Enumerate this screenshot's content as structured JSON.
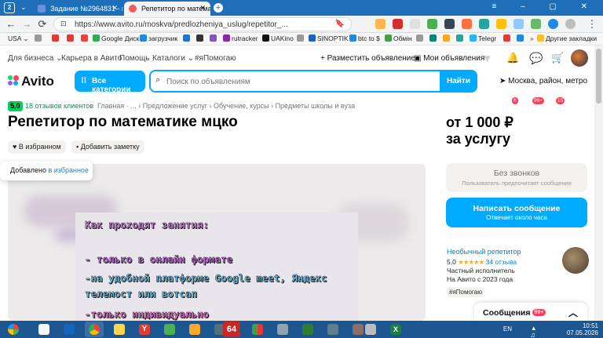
{
  "browser": {
    "tabs": [
      {
        "label": "Задание №2964831 - про"
      },
      {
        "label": "Репетитор по математи"
      }
    ],
    "tab_counter": "2",
    "url": "https://www.avito.ru/moskva/predlozheniya_uslug/repetitor_...",
    "bookmarks": [
      "USA",
      "Google Диск",
      "загрузчик",
      "rutracker",
      "UAKino",
      "SINOPTIK",
      "btc to $",
      "Обмін",
      "Telegr",
      "Другие закладки"
    ]
  },
  "header": {
    "links": [
      "Для бизнеса",
      "Карьера в Авито",
      "Помощь",
      "Каталоги",
      "#яПомогаю"
    ],
    "post_ad": "Разместить объявление",
    "my_ads": "Мои объявления",
    "badges": [
      "6",
      "99+",
      "15"
    ]
  },
  "search": {
    "logo": "Avito",
    "categories_btn": "Все категории",
    "placeholder": "Поиск по объявлениям",
    "find_btn": "Найти",
    "location": "Москва, район, метро"
  },
  "listing": {
    "rating": "5,0",
    "reviews": "18 отзывов клиентов",
    "breadcrumbs": "Главная · ... › Предложение услуг › Обучение, курсы › Предметы школы и вуза",
    "title": "Репетитор по математике мцко",
    "favorite": "В избранном",
    "note": "Добавить заметку",
    "toast_text": "Добавлено ",
    "toast_link": "в избранное",
    "slide_lines": [
      "Как проходят занятия:",
      "- только в онлайн формате",
      "-на удобной платформе Google meet, Яндекс",
      "телемост или вотсап",
      "-только индивидуально"
    ]
  },
  "sidebar": {
    "price_line1": "от 1 000 ₽",
    "price_line2": "за услугу",
    "no_calls": "Без звонков",
    "no_calls_sub": "Пользователь предпочитает сообщения",
    "write_msg": "Написать сообщение",
    "write_msg_sub": "Отвечает около часа",
    "seller_name": "Необычный репетитор",
    "seller_rating": "5,0",
    "stars": "★★★★★",
    "seller_reviews": "34 отзыва",
    "seller_type": "Частный исполнитель",
    "seller_since": "На Авито с 2023 года",
    "tag": "#яПомогаю",
    "messages_panel": "Сообщения",
    "messages_badge": "99+"
  },
  "taskbar": {
    "lang": "EN",
    "time": "10:51",
    "date": "07.05.2026",
    "app_label": "64"
  },
  "colors": {
    "accent": "#00aaff",
    "green": "#02d15c",
    "badge": "#ff3d5a"
  }
}
